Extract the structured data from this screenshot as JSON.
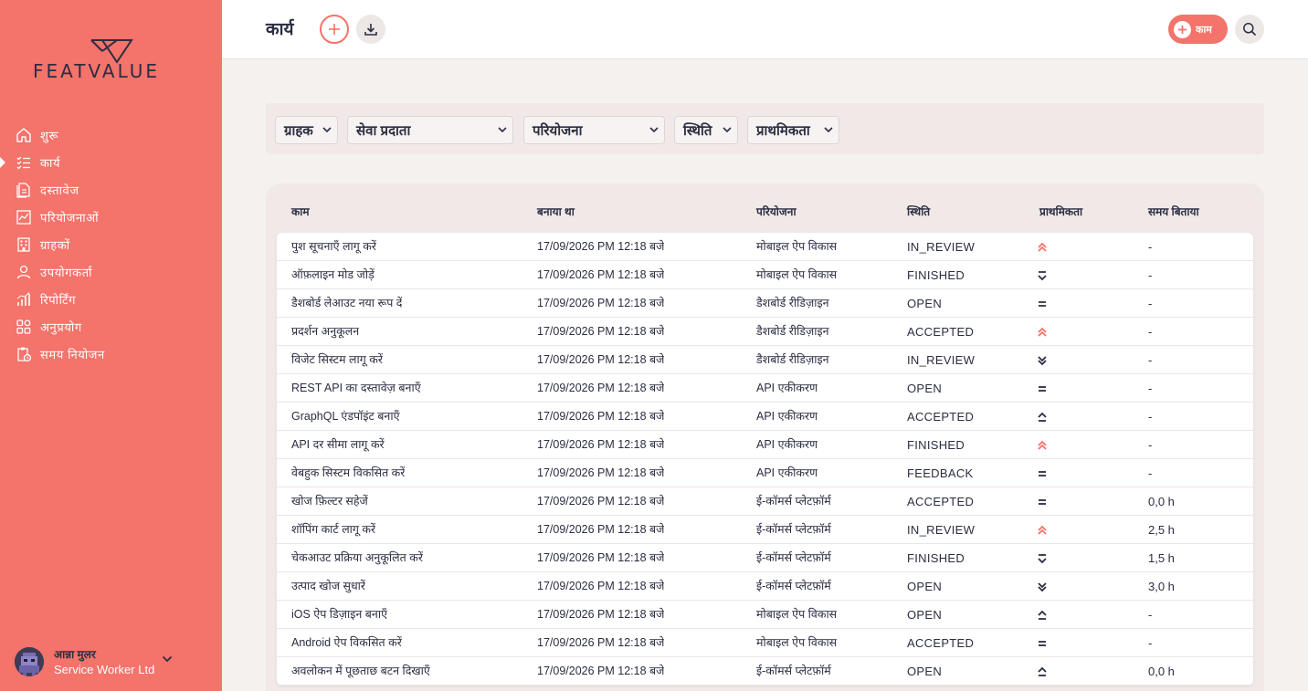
{
  "app": {
    "logo_text": "FEATVALUE"
  },
  "sidebar": {
    "items": [
      {
        "label": "शुरू",
        "icon": "home-icon"
      },
      {
        "label": "कार्य",
        "icon": "task-list-icon",
        "active": true
      },
      {
        "label": "दस्तावेज",
        "icon": "documents-icon"
      },
      {
        "label": "परियोजनाओं",
        "icon": "projects-chart-icon"
      },
      {
        "label": "ग्राहकों",
        "icon": "building-icon"
      },
      {
        "label": "उपयोगकर्ता",
        "icon": "user-icon"
      },
      {
        "label": "रिपोर्टिंग",
        "icon": "reporting-bars-icon"
      },
      {
        "label": "अनुप्रयोग",
        "icon": "apps-grid-icon"
      },
      {
        "label": "समय नियोजन",
        "icon": "time-planning-icon"
      }
    ],
    "user": {
      "name": "आन्ना मुलर",
      "org": "Service Worker Ltd"
    }
  },
  "header": {
    "title": "कार्य",
    "task_button_label": "काम"
  },
  "filters": [
    {
      "label": "ग्राहक"
    },
    {
      "label": "सेवा प्रदाता"
    },
    {
      "label": "परियोजना"
    },
    {
      "label": "स्थिति"
    },
    {
      "label": "प्राथमिकता"
    }
  ],
  "table": {
    "columns": [
      "काम",
      "बनाया था",
      "परियोजना",
      "स्थिति",
      "प्राथमिकता",
      "समय बिताया"
    ],
    "rows": [
      {
        "task": "पुश सूचनाएँ लागू करें",
        "created": "17/09/2026 PM 12:18 बजे",
        "project": "मोबाइल ऐप विकास",
        "status": "IN_REVIEW",
        "priority": "highest",
        "time": "-"
      },
      {
        "task": "ऑफ़लाइन मोड जोड़ें",
        "created": "17/09/2026 PM 12:18 बजे",
        "project": "मोबाइल ऐप विकास",
        "status": "FINISHED",
        "priority": "lowest",
        "time": "-"
      },
      {
        "task": "डैशबोर्ड लेआउट नया रूप दें",
        "created": "17/09/2026 PM 12:18 बजे",
        "project": "डैशबोर्ड रीडिज़ाइन",
        "status": "OPEN",
        "priority": "medium",
        "time": "-"
      },
      {
        "task": "प्रदर्शन अनुकूलन",
        "created": "17/09/2026 PM 12:18 बजे",
        "project": "डैशबोर्ड रीडिज़ाइन",
        "status": "ACCEPTED",
        "priority": "highest",
        "time": "-"
      },
      {
        "task": "विजेट सिस्टम लागू करें",
        "created": "17/09/2026 PM 12:18 बजे",
        "project": "डैशबोर्ड रीडिज़ाइन",
        "status": "IN_REVIEW",
        "priority": "low",
        "time": "-"
      },
      {
        "task": "REST API का दस्तावेज़ बनाएँ",
        "created": "17/09/2026 PM 12:18 बजे",
        "project": "API एकीकरण",
        "status": "OPEN",
        "priority": "medium",
        "time": "-"
      },
      {
        "task": "GraphQL एंडपॉइंट बनाएँ",
        "created": "17/09/2026 PM 12:18 बजे",
        "project": "API एकीकरण",
        "status": "ACCEPTED",
        "priority": "high",
        "time": "-"
      },
      {
        "task": "API दर सीमा लागू करें",
        "created": "17/09/2026 PM 12:18 बजे",
        "project": "API एकीकरण",
        "status": "FINISHED",
        "priority": "highest",
        "time": "-"
      },
      {
        "task": "वेबहुक सिस्टम विकसित करें",
        "created": "17/09/2026 PM 12:18 बजे",
        "project": "API एकीकरण",
        "status": "FEEDBACK",
        "priority": "medium",
        "time": "-"
      },
      {
        "task": "खोज फ़िल्टर सहेजें",
        "created": "17/09/2026 PM 12:18 बजे",
        "project": "ई-कॉमर्स प्लेटफ़ॉर्म",
        "status": "ACCEPTED",
        "priority": "medium",
        "time": "0,0 h"
      },
      {
        "task": "शॉपिंग कार्ट लागू करें",
        "created": "17/09/2026 PM 12:18 बजे",
        "project": "ई-कॉमर्स प्लेटफ़ॉर्म",
        "status": "IN_REVIEW",
        "priority": "highest",
        "time": "2,5 h"
      },
      {
        "task": "चेकआउट प्रक्रिया अनुकूलित करें",
        "created": "17/09/2026 PM 12:18 बजे",
        "project": "ई-कॉमर्स प्लेटफ़ॉर्म",
        "status": "FINISHED",
        "priority": "lowest",
        "time": "1,5 h"
      },
      {
        "task": "उत्पाद खोज सुधारें",
        "created": "17/09/2026 PM 12:18 बजे",
        "project": "ई-कॉमर्स प्लेटफ़ॉर्म",
        "status": "OPEN",
        "priority": "low",
        "time": "3,0 h"
      },
      {
        "task": "iOS ऐप डिज़ाइन बनाएँ",
        "created": "17/09/2026 PM 12:18 बजे",
        "project": "मोबाइल ऐप विकास",
        "status": "OPEN",
        "priority": "high",
        "time": "-"
      },
      {
        "task": "Android ऐप विकसित करें",
        "created": "17/09/2026 PM 12:18 बजे",
        "project": "मोबाइल ऐप विकास",
        "status": "ACCEPTED",
        "priority": "medium",
        "time": "-"
      },
      {
        "task": "अवलोकन में पूछताछ बटन दिखाएँ",
        "created": "17/09/2026 PM 12:18 बजे",
        "project": "ई-कॉमर्स प्लेटफ़ॉर्म",
        "status": "OPEN",
        "priority": "high",
        "time": "0,0 h"
      }
    ]
  },
  "colors": {
    "brand": "#f4736a",
    "text_dark": "#2b2d42",
    "priority_highest": "#f4736a",
    "priority_other": "#2b2d42"
  }
}
